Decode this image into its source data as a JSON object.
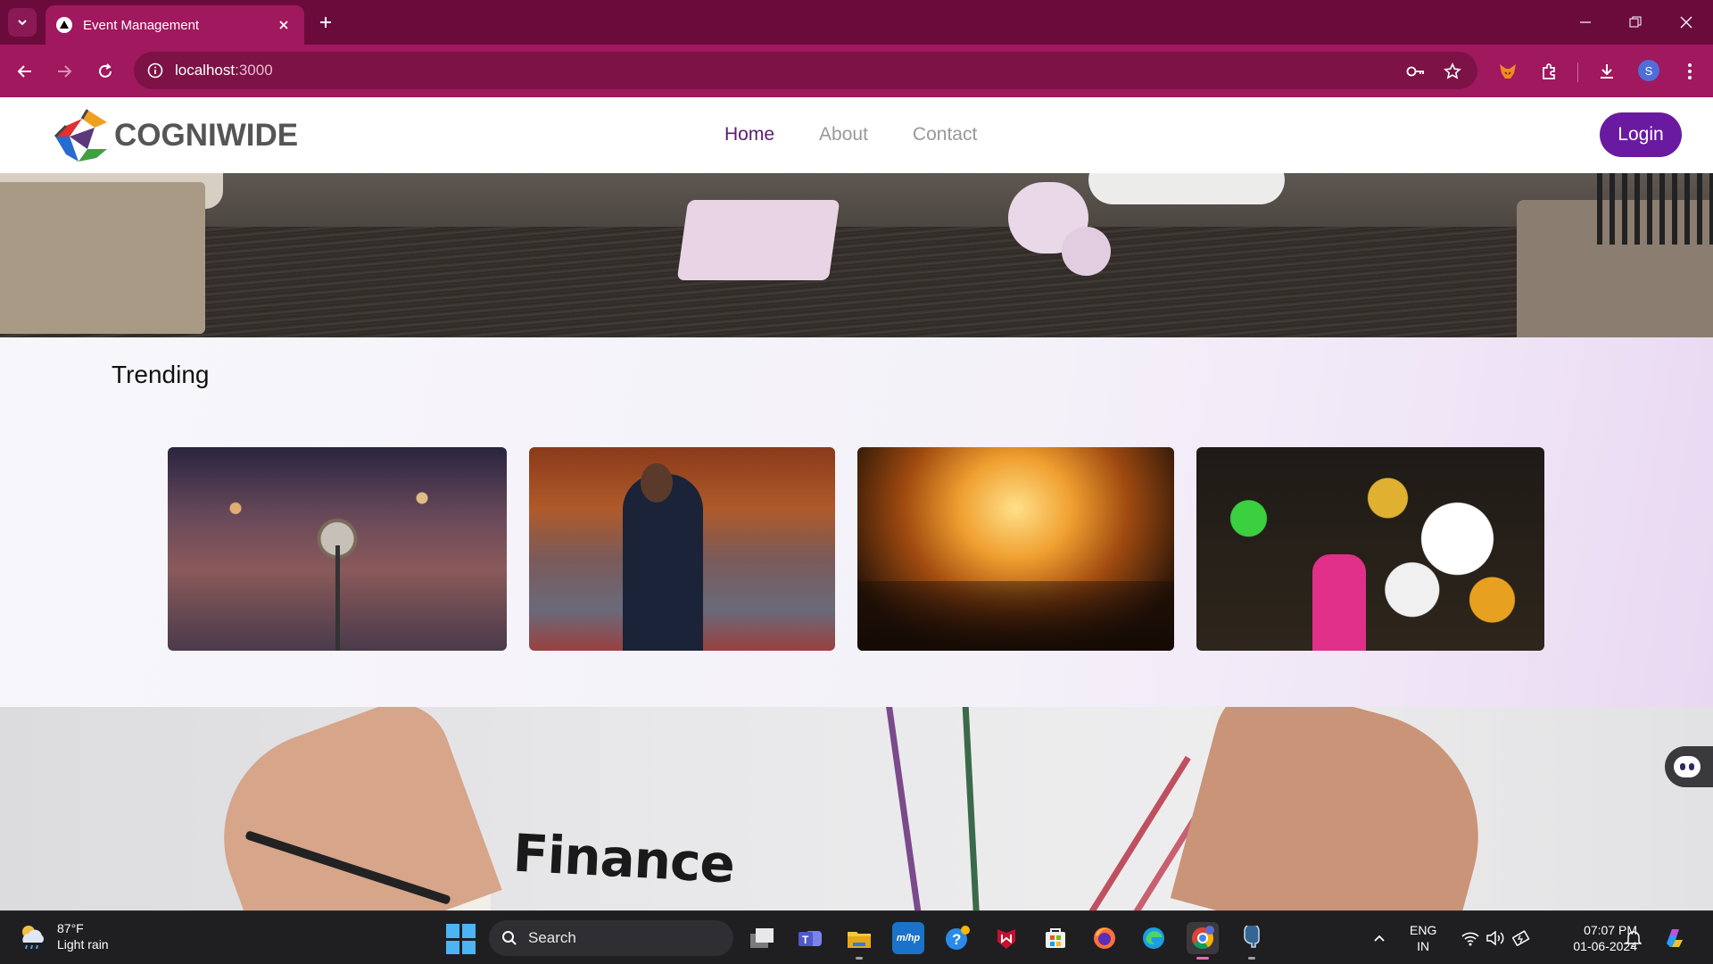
{
  "browser": {
    "tab_title": "Event Management",
    "url_host": "localhost",
    "url_port": ":3000",
    "profile_initial": "S"
  },
  "site": {
    "logo_text": "COGNIWIDE",
    "nav": [
      {
        "label": "Home",
        "active": true
      },
      {
        "label": "About",
        "active": false
      },
      {
        "label": "Contact",
        "active": false
      }
    ],
    "login_label": "Login",
    "accent_color": "#6a1aa0",
    "nav_active_color": "#5c1a73"
  },
  "trending": {
    "title": "Trending",
    "cards": [
      {
        "image": "microphone-stage"
      },
      {
        "image": "conference-speaker"
      },
      {
        "image": "concert-crowd"
      },
      {
        "image": "party-balloons"
      }
    ]
  },
  "finance_banner": {
    "word": "Finance"
  },
  "taskbar": {
    "weather_temp": "87°F",
    "weather_desc": "Light rain",
    "search_label": "Search",
    "lang_line1": "ENG",
    "lang_line2": "IN",
    "time": "07:07 PM",
    "date": "01-06-2024"
  },
  "colors": {
    "tabbar": "#6b0b3c",
    "toolbar": "#a0185e",
    "taskbar": "#1f1f22"
  }
}
